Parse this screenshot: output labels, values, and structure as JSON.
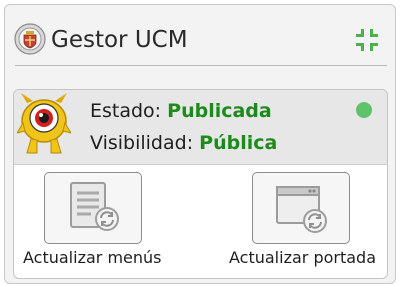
{
  "header": {
    "title": "Gestor UCM",
    "logo_icon": "university-seal-icon",
    "collapse_icon": "collapse-arrows-icon"
  },
  "status": {
    "state_label": "Estado:",
    "state_value": "Publicada",
    "visibility_label": "Visibilidad:",
    "visibility_value": "Pública",
    "indicator_color": "#5fc36a",
    "mascot_icon": "one-eyed-monster-icon"
  },
  "actions": [
    {
      "label": "Actualizar menús",
      "icon": "menu-refresh-icon"
    },
    {
      "label": "Actualizar portada",
      "icon": "window-refresh-icon"
    }
  ],
  "colors": {
    "accent_green": "#1d8a1d",
    "mascot_yellow": "#f0c419"
  }
}
